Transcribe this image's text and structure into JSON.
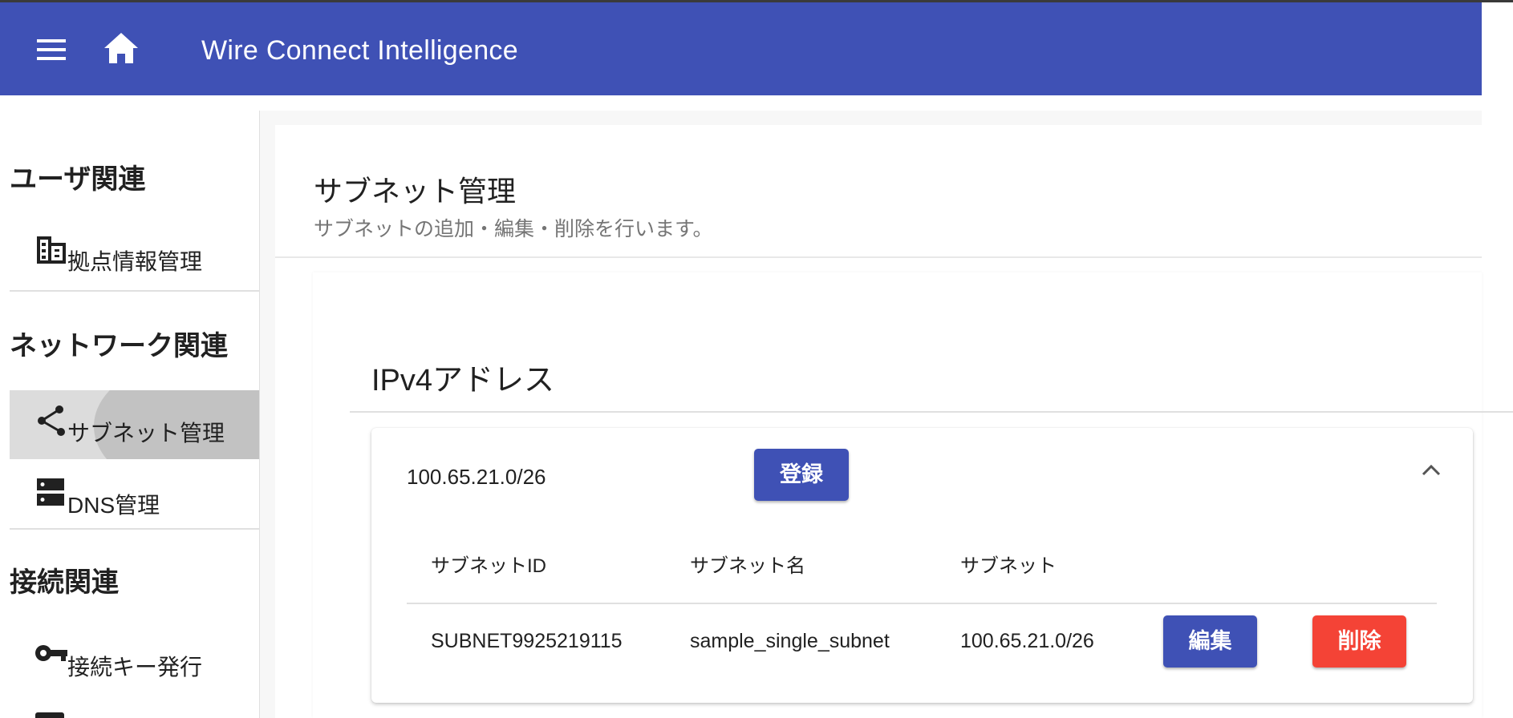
{
  "app": {
    "title": "Wire Connect Intelligence",
    "menu_icon": "menu-icon",
    "home_icon": "home-icon",
    "colors": {
      "primary": "#3f51b5",
      "danger": "#f44336"
    }
  },
  "sidebar": {
    "sections": [
      {
        "heading": "ユーザ関連",
        "items": [
          {
            "label": "拠点情報管理",
            "icon": "domain-icon"
          }
        ]
      },
      {
        "heading": "ネットワーク関連",
        "items": [
          {
            "label": "サブネット管理",
            "icon": "share-icon",
            "active": true
          },
          {
            "label": "DNS管理",
            "icon": "dns-icon"
          }
        ]
      },
      {
        "heading": "接続関連",
        "items": [
          {
            "label": "接続キー発行",
            "icon": "key-icon"
          }
        ]
      }
    ]
  },
  "page": {
    "title": "サブネット管理",
    "subtitle": "サブネットの追加・編集・削除を行います。"
  },
  "ipv4": {
    "section_title": "IPv4アドレス",
    "panel": {
      "subnet": "100.65.21.0/26",
      "register_label": "登録",
      "expand_icon": "chevron-up-icon",
      "columns": [
        "サブネットID",
        "サブネット名",
        "サブネット"
      ],
      "rows": [
        {
          "id": "SUBNET9925219115",
          "name": "sample_single_subnet",
          "subnet": "100.65.21.0/26",
          "edit_label": "編集",
          "delete_label": "削除"
        }
      ]
    }
  }
}
